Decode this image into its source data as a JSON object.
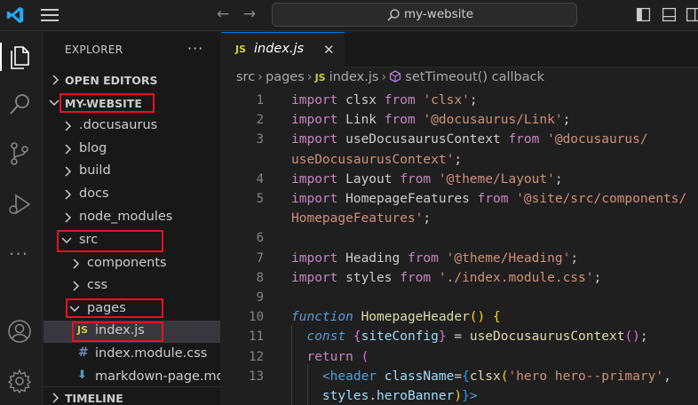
{
  "titlebar": {
    "search_text": "my-website"
  },
  "sidebar": {
    "title": "EXPLORER",
    "more": "···",
    "open_editors": "OPEN EDITORS",
    "project": "MY-WEBSITE",
    "items": [
      {
        "label": ".docusaurus"
      },
      {
        "label": "blog"
      },
      {
        "label": "build"
      },
      {
        "label": "docs"
      },
      {
        "label": "node_modules"
      },
      {
        "label": "src"
      },
      {
        "label": "components"
      },
      {
        "label": "css"
      },
      {
        "label": "pages"
      },
      {
        "label": "index.js",
        "icon": "JS"
      },
      {
        "label": "index.module.css",
        "icon": "#"
      },
      {
        "label": "markdown-page.md",
        "icon": "⬇"
      }
    ],
    "timeline": "TIMELINE"
  },
  "tab": {
    "icon": "JS",
    "label": "index.js",
    "close": "✕"
  },
  "breadcrumb": {
    "parts": [
      "src",
      "pages",
      "index.js",
      "setTimeout() callback"
    ],
    "js_icon": "JS"
  },
  "code": {
    "line_numbers": [
      "1",
      "2",
      "3",
      "",
      "4",
      "5",
      "",
      "6",
      "7",
      "8",
      "9",
      "10",
      "11",
      "12",
      "13",
      ""
    ],
    "lines": [
      {
        "t": [
          [
            "kw",
            "import"
          ],
          [
            "punc",
            " clsx "
          ],
          [
            "kw",
            "from"
          ],
          [
            "punc",
            " "
          ],
          [
            "str",
            "'clsx'"
          ],
          [
            "punc",
            ";"
          ]
        ]
      },
      {
        "t": [
          [
            "kw",
            "import"
          ],
          [
            "punc",
            " Link "
          ],
          [
            "kw",
            "from"
          ],
          [
            "punc",
            " "
          ],
          [
            "str",
            "'@docusaurus/Link'"
          ],
          [
            "punc",
            ";"
          ]
        ]
      },
      {
        "t": [
          [
            "kw",
            "import"
          ],
          [
            "punc",
            " useDocusaurusContext "
          ],
          [
            "kw",
            "from"
          ],
          [
            "punc",
            " "
          ],
          [
            "str",
            "'@docusaurus/"
          ]
        ]
      },
      {
        "t": [
          [
            "str",
            "useDocusaurusContext'"
          ],
          [
            "punc",
            ";"
          ]
        ]
      },
      {
        "t": [
          [
            "kw",
            "import"
          ],
          [
            "punc",
            " Layout "
          ],
          [
            "kw",
            "from"
          ],
          [
            "punc",
            " "
          ],
          [
            "str",
            "'@theme/Layout'"
          ],
          [
            "punc",
            ";"
          ]
        ]
      },
      {
        "t": [
          [
            "kw",
            "import"
          ],
          [
            "punc",
            " HomepageFeatures "
          ],
          [
            "kw",
            "from"
          ],
          [
            "punc",
            " "
          ],
          [
            "str",
            "'@site/src/components/"
          ]
        ]
      },
      {
        "t": [
          [
            "str",
            "HomepageFeatures'"
          ],
          [
            "punc",
            ";"
          ]
        ]
      },
      {
        "t": [
          [
            "punc",
            ""
          ]
        ]
      },
      {
        "t": [
          [
            "kw",
            "import"
          ],
          [
            "punc",
            " Heading "
          ],
          [
            "kw",
            "from"
          ],
          [
            "punc",
            " "
          ],
          [
            "str",
            "'@theme/Heading'"
          ],
          [
            "punc",
            ";"
          ]
        ]
      },
      {
        "t": [
          [
            "kw",
            "import"
          ],
          [
            "punc",
            " styles "
          ],
          [
            "kw",
            "from"
          ],
          [
            "punc",
            " "
          ],
          [
            "str",
            "'./index.module.css'"
          ],
          [
            "punc",
            ";"
          ]
        ]
      },
      {
        "t": [
          [
            "punc",
            ""
          ]
        ]
      },
      {
        "t": [
          [
            "kw2",
            "function"
          ],
          [
            "punc",
            " "
          ],
          [
            "fn",
            "HomepageHeader"
          ],
          [
            "brk2",
            "()"
          ],
          [
            "punc",
            " "
          ],
          [
            "brk2",
            "{"
          ]
        ]
      },
      {
        "t": [
          [
            "punc",
            "  "
          ],
          [
            "kw2",
            "const"
          ],
          [
            "punc",
            " "
          ],
          [
            "brk",
            "{"
          ],
          [
            "id",
            "siteConfig"
          ],
          [
            "brk",
            "}"
          ],
          [
            "punc",
            " = "
          ],
          [
            "fn",
            "useDocusaurusContext"
          ],
          [
            "brk",
            "()"
          ],
          [
            "punc",
            ";"
          ]
        ]
      },
      {
        "t": [
          [
            "punc",
            "  "
          ],
          [
            "kw",
            "return"
          ],
          [
            "punc",
            " "
          ],
          [
            "brk",
            "("
          ]
        ]
      },
      {
        "t": [
          [
            "punc",
            "    "
          ],
          [
            "tag",
            "<header"
          ],
          [
            "punc",
            " "
          ],
          [
            "attr",
            "className"
          ],
          [
            "punc",
            "="
          ],
          [
            "brk3",
            "{"
          ],
          [
            "fn",
            "clsx"
          ],
          [
            "brk2",
            "("
          ],
          [
            "str",
            "'hero hero--primary'"
          ],
          [
            "punc",
            ","
          ]
        ]
      },
      {
        "t": [
          [
            "punc",
            "    "
          ],
          [
            "id",
            "styles"
          ],
          [
            "punc",
            "."
          ],
          [
            "id",
            "heroBanner"
          ],
          [
            "brk2",
            ")"
          ],
          [
            "brk3",
            "}"
          ],
          [
            "tag",
            ">"
          ]
        ]
      }
    ]
  }
}
